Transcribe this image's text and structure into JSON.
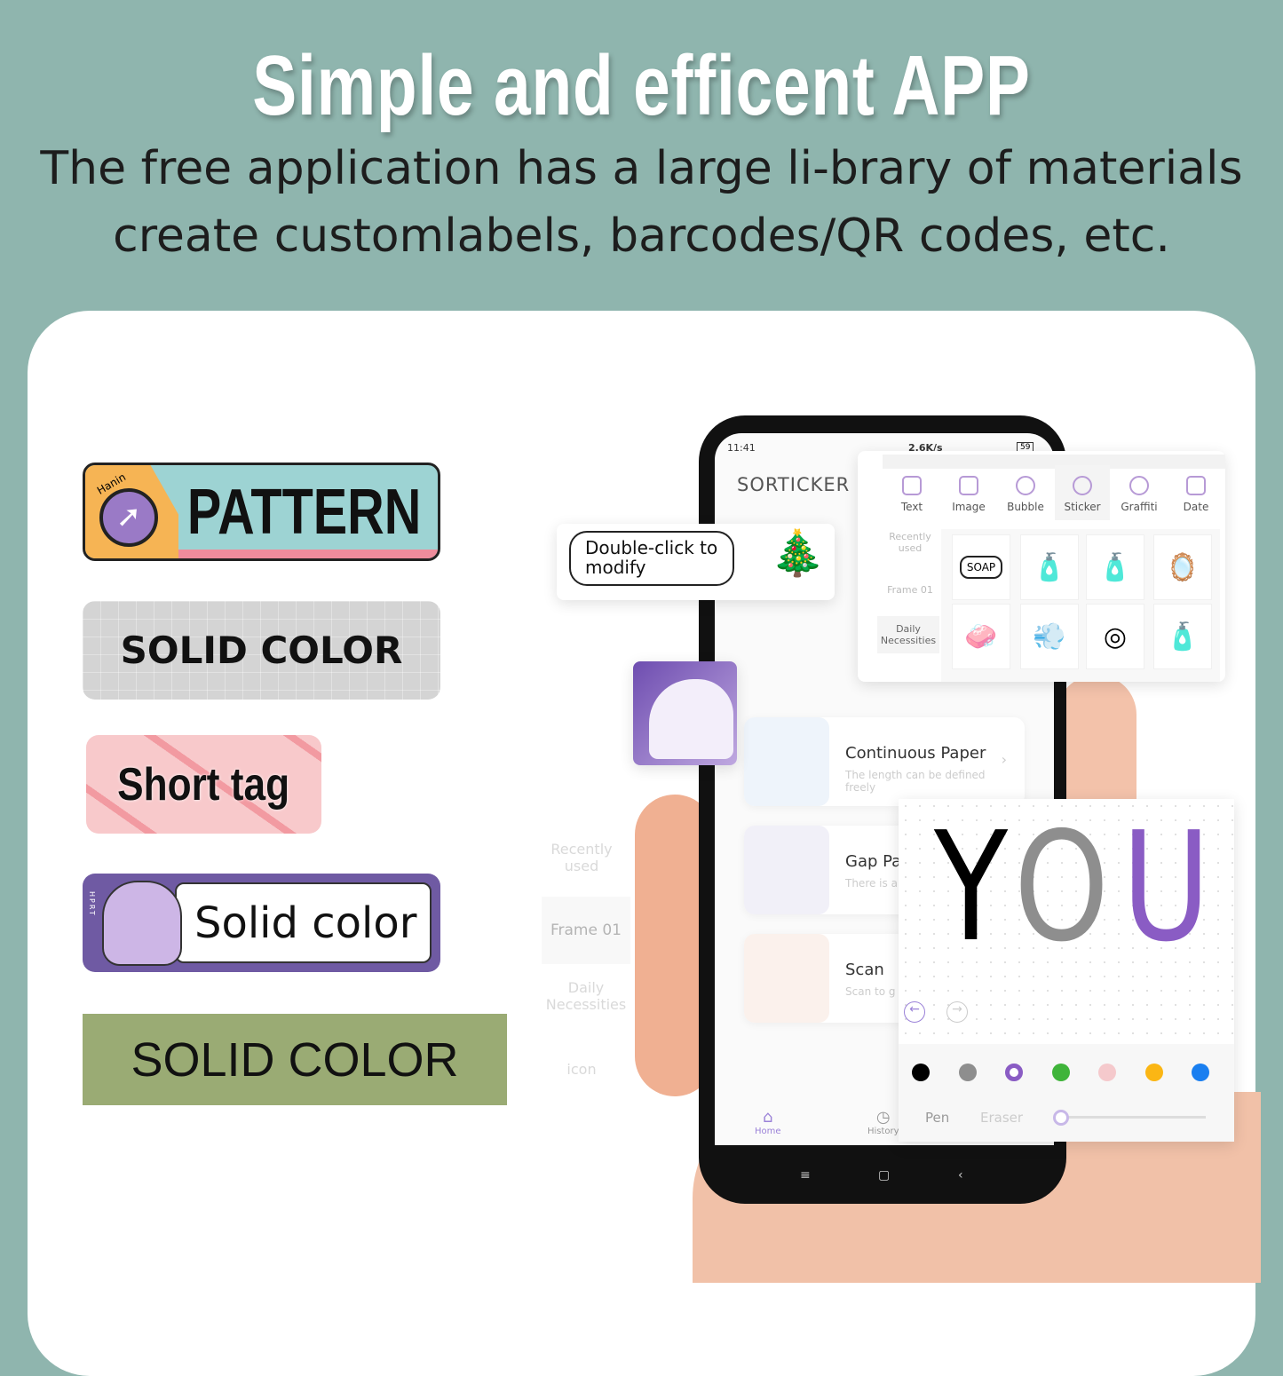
{
  "header": {
    "title": "Simple and efficent APP",
    "subtitle_line1": "The free application has a large li-brary of materials",
    "subtitle_line2": "create customlabels, barcodes/QR codes, etc."
  },
  "labels": [
    {
      "text": "PATTERN",
      "badge": "Hanin",
      "color": "#9dd3d3"
    },
    {
      "text": "SOLID COLOR",
      "color": "#d4d4d4"
    },
    {
      "text": "Short tag",
      "color": "#f8c9cb"
    },
    {
      "text": "Solid color",
      "badge": "HPRT",
      "color": "#6f5aa3"
    },
    {
      "text": "SOLID COLOR",
      "color": "#9aab74"
    }
  ],
  "phone": {
    "status": {
      "time": "11:41",
      "network": "2.6K/s",
      "battery": "59"
    },
    "app_name": "SORTICKER",
    "cards": [
      {
        "title": "Continuous Paper",
        "desc": "The length can be defined freely"
      },
      {
        "title": "Gap Pa",
        "desc": "There is a each piec"
      },
      {
        "title": "Scan",
        "desc": "Scan to g"
      }
    ],
    "nav": [
      {
        "label": "Home",
        "icon": "home-icon"
      },
      {
        "label": "History",
        "icon": "clock-icon"
      }
    ]
  },
  "bubble_panel": {
    "text": "Double-click to modify"
  },
  "sticker_panel": {
    "tabs": [
      "Text",
      "Image",
      "Bubble",
      "Sticker",
      "Graffiti",
      "Date"
    ],
    "active_tab": "Sticker",
    "categories": [
      "Recently used",
      "Frame 01",
      "Daily Necessities"
    ],
    "active_category": "Daily Necessities",
    "stickers": [
      "soap",
      "shampoo-bottle",
      "lotion-bottle",
      "mirror",
      "soap-dispenser",
      "hair-dryer",
      "tape-roll",
      "pump-bottle"
    ],
    "soap_label": "SOAP"
  },
  "left_list": {
    "items": [
      "Recently used",
      "Frame 01",
      "Daily Necessities",
      "icon"
    ]
  },
  "graffiti_panel": {
    "drawing": "YOU",
    "colors": [
      "#000000",
      "#8e8e8e",
      "#8a5cc4",
      "#3fb43a",
      "#f5c9cc",
      "#fbb614",
      "#1a7ff0"
    ],
    "selected_color": "#8a5cc4",
    "tools": [
      "Pen",
      "Eraser"
    ],
    "brush_size": 0.0
  }
}
